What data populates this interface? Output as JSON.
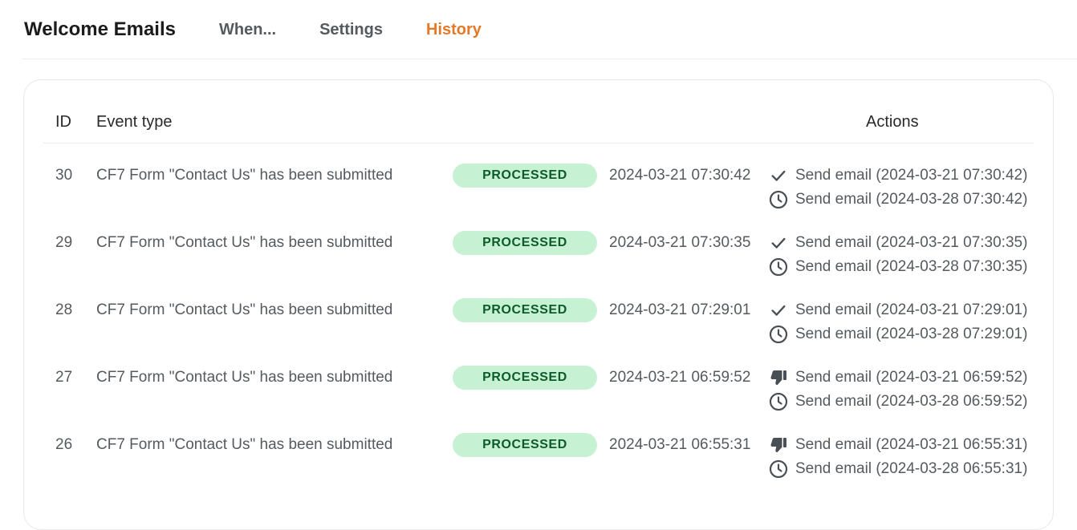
{
  "header": {
    "title": "Welcome Emails",
    "tabs": [
      {
        "label": "When...",
        "active": false
      },
      {
        "label": "Settings",
        "active": false
      },
      {
        "label": "History",
        "active": true
      }
    ]
  },
  "colors": {
    "accent": "#e4792a",
    "badge_bg": "#c6f1d3",
    "badge_text": "#0d5a2a",
    "text": "#555a5f"
  },
  "table": {
    "columns": {
      "id": "ID",
      "event_type": "Event type",
      "actions": "Actions"
    },
    "rows": [
      {
        "id": "30",
        "event": "CF7 Form \"Contact Us\" has been submitted",
        "status": "PROCESSED",
        "time": "2024-03-21 07:30:42",
        "actions": [
          {
            "icon": "check-icon",
            "label": "Send email (2024-03-21 07:30:42)"
          },
          {
            "icon": "clock-icon",
            "label": "Send email (2024-03-28 07:30:42)"
          }
        ]
      },
      {
        "id": "29",
        "event": "CF7 Form \"Contact Us\" has been submitted",
        "status": "PROCESSED",
        "time": "2024-03-21 07:30:35",
        "actions": [
          {
            "icon": "check-icon",
            "label": "Send email (2024-03-21 07:30:35)"
          },
          {
            "icon": "clock-icon",
            "label": "Send email (2024-03-28 07:30:35)"
          }
        ]
      },
      {
        "id": "28",
        "event": "CF7 Form \"Contact Us\" has been submitted",
        "status": "PROCESSED",
        "time": "2024-03-21 07:29:01",
        "actions": [
          {
            "icon": "check-icon",
            "label": "Send email (2024-03-21 07:29:01)"
          },
          {
            "icon": "clock-icon",
            "label": "Send email (2024-03-28 07:29:01)"
          }
        ]
      },
      {
        "id": "27",
        "event": "CF7 Form \"Contact Us\" has been submitted",
        "status": "PROCESSED",
        "time": "2024-03-21 06:59:52",
        "actions": [
          {
            "icon": "thumbs-down-icon",
            "label": "Send email (2024-03-21 06:59:52)"
          },
          {
            "icon": "clock-icon",
            "label": "Send email (2024-03-28 06:59:52)"
          }
        ]
      },
      {
        "id": "26",
        "event": "CF7 Form \"Contact Us\" has been submitted",
        "status": "PROCESSED",
        "time": "2024-03-21 06:55:31",
        "actions": [
          {
            "icon": "thumbs-down-icon",
            "label": "Send email (2024-03-21 06:55:31)"
          },
          {
            "icon": "clock-icon",
            "label": "Send email (2024-03-28 06:55:31)"
          }
        ]
      }
    ]
  }
}
